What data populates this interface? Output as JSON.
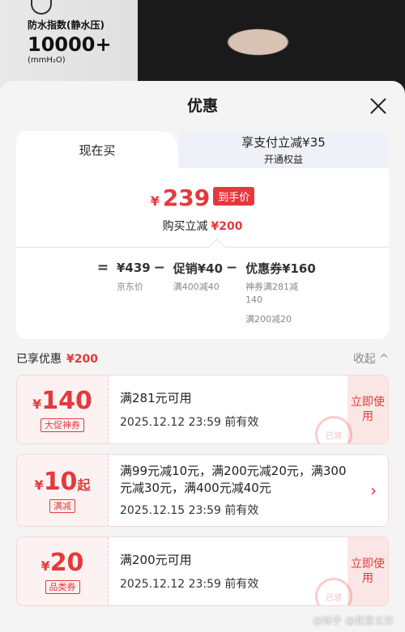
{
  "product": {
    "spec_label": "防水指数(静水压)",
    "spec_value": "10000+",
    "spec_unit": "(mmH₂O)"
  },
  "sheet": {
    "title": "优惠"
  },
  "tabs": {
    "active": "现在买",
    "other_line1": "享支付立减¥35",
    "other_line2": "开通权益"
  },
  "price": {
    "currency": "¥",
    "value": "239",
    "badge": "到手价",
    "reduce_label": "购买立减",
    "reduce_amount": "¥200"
  },
  "formula": {
    "eq": "=",
    "base": "¥439",
    "base_sub": "京东价",
    "minus1": "−",
    "promo": "促销¥40",
    "promo_sub": "满400减40",
    "minus2": "−",
    "coupon": "优惠券¥160",
    "coupon_sub1": "神券满281减140",
    "coupon_sub2": "满200减20"
  },
  "enjoyed": {
    "label": "已享优惠",
    "amount": "¥200",
    "collapse": "收起 ^"
  },
  "coupons": [
    {
      "currency": "¥",
      "amount": "140",
      "suffix": "",
      "tag": "大促神券",
      "title": "满281元可用",
      "date": "2025.12.12 23:59 前有效",
      "action": "立即使用",
      "stamp": "已领"
    },
    {
      "currency": "¥",
      "amount": "10",
      "suffix": "起",
      "tag": "满减",
      "title": "满99元减10元，满200元减20元，满300元减30元，满400元减40元",
      "date": "2025.12.15 23:59 前有效",
      "action": "›"
    },
    {
      "currency": "¥",
      "amount": "20",
      "suffix": "",
      "tag": "品类券",
      "title": "满200元可用",
      "date": "2025.12.12 23:59 前有效",
      "action": "立即使用",
      "stamp": "已领"
    }
  ],
  "watermark": "@知乎 @我爱北京"
}
